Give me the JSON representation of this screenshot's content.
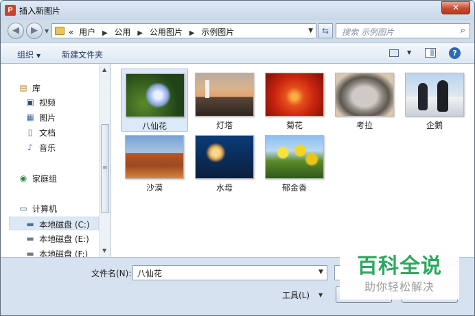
{
  "window": {
    "title": "插入新图片",
    "app_icon_letter": "P",
    "close_symbol": "✕"
  },
  "address": {
    "crumbs": [
      "用户",
      "公用",
      "公用图片",
      "示例图片"
    ],
    "lead_symbol": "«"
  },
  "search": {
    "placeholder": "搜索 示例图片"
  },
  "toolbar": {
    "organize": "组织",
    "new_folder": "新建文件夹"
  },
  "nav": {
    "items": [
      {
        "label": "库",
        "icon": "library-icon"
      },
      {
        "label": "视频",
        "icon": "video-icon"
      },
      {
        "label": "图片",
        "icon": "pictures-icon"
      },
      {
        "label": "文档",
        "icon": "document-icon"
      },
      {
        "label": "音乐",
        "icon": "music-icon"
      },
      {
        "label": "家庭组",
        "icon": "homegroup-icon"
      },
      {
        "label": "计算机",
        "icon": "computer-icon"
      },
      {
        "label": "本地磁盘 (C:)",
        "icon": "disk-c-icon"
      },
      {
        "label": "本地磁盘 (E:)",
        "icon": "disk-icon"
      },
      {
        "label": "本地磁盘 (F:)",
        "icon": "disk-icon"
      }
    ]
  },
  "files": [
    {
      "name": "八仙花",
      "selected": true
    },
    {
      "name": "灯塔"
    },
    {
      "name": "菊花"
    },
    {
      "name": "考拉"
    },
    {
      "name": "企鹅"
    },
    {
      "name": "沙漠"
    },
    {
      "name": "水母"
    },
    {
      "name": "郁金香"
    }
  ],
  "bottom": {
    "filename_label": "文件名(N):",
    "filename_value": "八仙花",
    "tools_label": "工具(L)"
  },
  "watermark": {
    "title": "百科全说",
    "subtitle": "助你轻松解决"
  }
}
